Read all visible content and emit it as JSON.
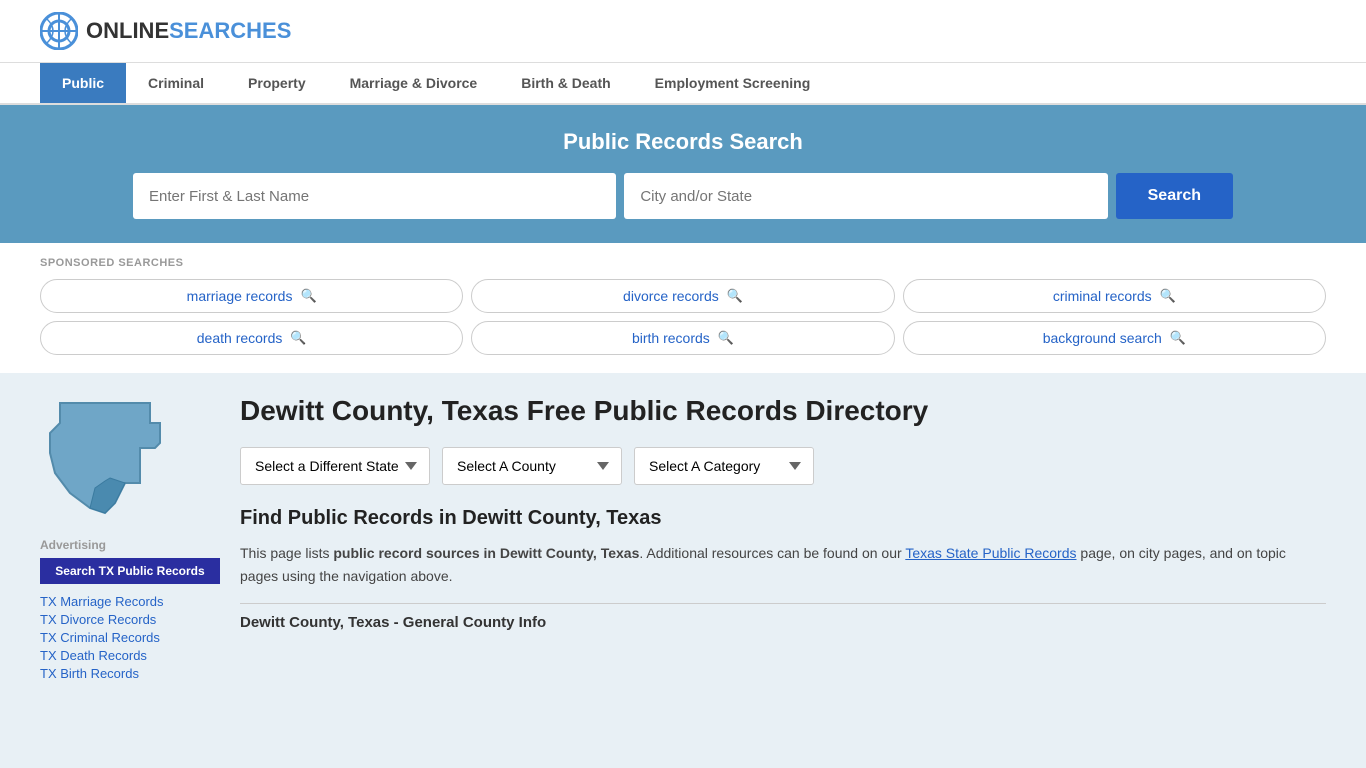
{
  "header": {
    "logo_online": "ONLINE",
    "logo_searches": "SEARCHES"
  },
  "nav": {
    "items": [
      {
        "label": "Public",
        "active": true
      },
      {
        "label": "Criminal",
        "active": false
      },
      {
        "label": "Property",
        "active": false
      },
      {
        "label": "Marriage & Divorce",
        "active": false
      },
      {
        "label": "Birth & Death",
        "active": false
      },
      {
        "label": "Employment Screening",
        "active": false
      }
    ]
  },
  "hero": {
    "title": "Public Records Search",
    "name_placeholder": "Enter First & Last Name",
    "location_placeholder": "City and/or State",
    "search_button": "Search"
  },
  "sponsored": {
    "label": "SPONSORED SEARCHES",
    "items": [
      {
        "text": "marriage records"
      },
      {
        "text": "divorce records"
      },
      {
        "text": "criminal records"
      },
      {
        "text": "death records"
      },
      {
        "text": "birth records"
      },
      {
        "text": "background search"
      }
    ]
  },
  "sidebar": {
    "advertising_label": "Advertising",
    "ad_button": "Search TX Public Records",
    "links": [
      {
        "text": "TX Marriage Records"
      },
      {
        "text": "TX Divorce Records"
      },
      {
        "text": "TX Criminal Records"
      },
      {
        "text": "TX Death Records"
      },
      {
        "text": "TX Birth Records"
      }
    ]
  },
  "content": {
    "page_title": "Dewitt County, Texas Free Public Records Directory",
    "dropdowns": {
      "state": "Select a Different State",
      "county": "Select A County",
      "category": "Select A Category"
    },
    "find_title": "Find Public Records in Dewitt County, Texas",
    "find_text_1": "This page lists ",
    "find_text_bold": "public record sources in Dewitt County, Texas",
    "find_text_2": ". Additional resources can be found on our ",
    "find_link": "Texas State Public Records",
    "find_text_3": " page, on city pages, and on topic pages using the navigation above.",
    "general_info": "Dewitt County, Texas - General County Info"
  }
}
